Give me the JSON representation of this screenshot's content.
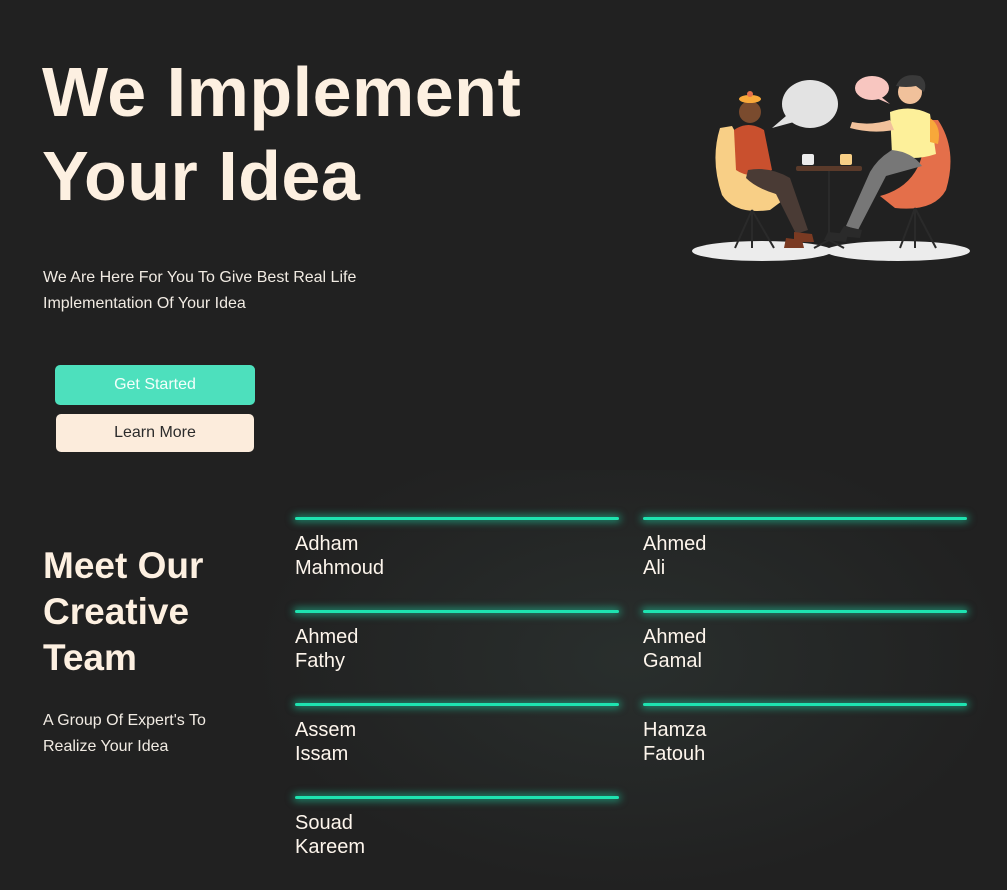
{
  "hero": {
    "title_line1": "We Implement",
    "title_line2": "Your Idea",
    "subtitle": "We Are Here For You To Give Best Real Life Implementation Of Your Idea",
    "get_started_label": "Get Started",
    "learn_more_label": "Learn More"
  },
  "team": {
    "title_line1": "Meet Our",
    "title_line2": "Creative",
    "title_line3": "Team",
    "subtitle": "A Group Of Expert's To Realize Your Idea",
    "members": [
      {
        "first": "Adham",
        "last": "Mahmoud"
      },
      {
        "first": "Ahmed",
        "last": "Ali"
      },
      {
        "first": "Ahmed",
        "last": "Fathy"
      },
      {
        "first": "Ahmed",
        "last": "Gamal"
      },
      {
        "first": "Assem",
        "last": "Issam"
      },
      {
        "first": "Hamza",
        "last": "Fatouh"
      },
      {
        "first": "Souad",
        "last": "Kareem"
      }
    ]
  },
  "colors": {
    "background": "#212121",
    "accent": "#4de0bd",
    "glow_line": "#1ee3b0",
    "cream": "#fdf0e1"
  },
  "icons": {
    "illustration": "two-people-chatting-illustration"
  }
}
